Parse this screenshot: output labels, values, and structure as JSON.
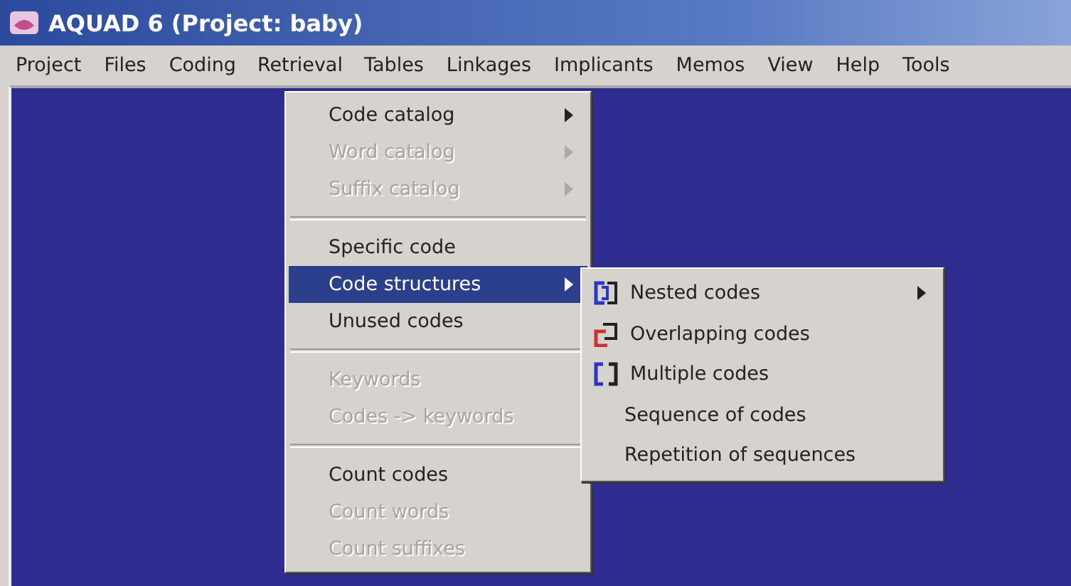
{
  "window": {
    "title": "AQUAD 6 (Project: baby)"
  },
  "menubar": [
    {
      "label": "Project",
      "selected": false
    },
    {
      "label": "Files",
      "selected": false
    },
    {
      "label": "Coding",
      "selected": false
    },
    {
      "label": "Retrieval",
      "selected": true
    },
    {
      "label": "Tables",
      "selected": false
    },
    {
      "label": "Linkages",
      "selected": false
    },
    {
      "label": "Implicants",
      "selected": false
    },
    {
      "label": "Memos",
      "selected": false
    },
    {
      "label": "View",
      "selected": false
    },
    {
      "label": "Help",
      "selected": false
    },
    {
      "label": "Tools",
      "selected": false
    }
  ],
  "menu": [
    {
      "kind": "item",
      "label": "Code catalog",
      "disabled": false,
      "submenu": true,
      "selected": false
    },
    {
      "kind": "item",
      "label": "Word catalog",
      "disabled": true,
      "submenu": true,
      "selected": false
    },
    {
      "kind": "item",
      "label": "Suffix catalog",
      "disabled": true,
      "submenu": true,
      "selected": false
    },
    {
      "kind": "separator"
    },
    {
      "kind": "item",
      "label": "Specific code",
      "disabled": false,
      "submenu": false,
      "selected": false
    },
    {
      "kind": "item",
      "label": "Code structures",
      "disabled": false,
      "submenu": true,
      "selected": true
    },
    {
      "kind": "item",
      "label": "Unused codes",
      "disabled": false,
      "submenu": false,
      "selected": false
    },
    {
      "kind": "separator"
    },
    {
      "kind": "item",
      "label": "Keywords",
      "disabled": true,
      "submenu": false,
      "selected": false
    },
    {
      "kind": "item",
      "label": "Codes -> keywords",
      "disabled": true,
      "submenu": false,
      "selected": false
    },
    {
      "kind": "separator"
    },
    {
      "kind": "item",
      "label": "Count codes",
      "disabled": false,
      "submenu": false,
      "selected": false
    },
    {
      "kind": "item",
      "label": "Count words",
      "disabled": true,
      "submenu": false,
      "selected": false
    },
    {
      "kind": "item",
      "label": "Count suffixes",
      "disabled": true,
      "submenu": false,
      "selected": false
    }
  ],
  "submenu": [
    {
      "label": "Nested codes",
      "kind": "nested",
      "submenu": true
    },
    {
      "label": "Overlapping codes",
      "kind": "overlapping",
      "submenu": false
    },
    {
      "label": "Multiple codes",
      "kind": "multiple",
      "submenu": false
    },
    {
      "label": "Sequence of codes",
      "kind": "plain",
      "submenu": false
    },
    {
      "label": "Repetition of sequences",
      "kind": "plain",
      "submenu": false
    }
  ]
}
